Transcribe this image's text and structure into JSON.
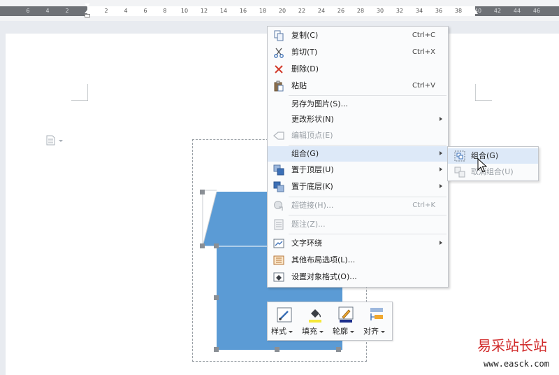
{
  "ruler": {
    "numbers": [
      "6",
      "4",
      "2",
      "2",
      "4",
      "6",
      "8",
      "10",
      "12",
      "14",
      "16",
      "18",
      "20",
      "22",
      "24",
      "26",
      "28",
      "30",
      "32",
      "34",
      "36",
      "38",
      "40",
      "42",
      "44",
      "46"
    ]
  },
  "context_menu": {
    "items": [
      {
        "label": "复制(C)",
        "shortcut": "Ctrl+C",
        "icon": "copy-icon"
      },
      {
        "label": "剪切(T)",
        "shortcut": "Ctrl+X",
        "icon": "scissors-icon"
      },
      {
        "label": "删除(D)",
        "icon": "delete-x-icon"
      },
      {
        "label": "粘贴",
        "shortcut": "Ctrl+V",
        "icon": "paste-icon"
      },
      {
        "label": "另存为图片(S)..."
      },
      {
        "label": "更改形状(N)"
      },
      {
        "label": "编辑顶点(E)",
        "icon": "edit-points-icon"
      },
      {
        "label": "组合(G)"
      },
      {
        "label": "置于顶层(U)",
        "icon": "bring-front-icon"
      },
      {
        "label": "置于底层(K)",
        "icon": "send-back-icon"
      },
      {
        "label": "超链接(H)...",
        "shortcut": "Ctrl+K",
        "icon": "hyperlink-icon"
      },
      {
        "label": "题注(Z)...",
        "icon": "caption-icon"
      },
      {
        "label": "文字环绕",
        "icon": "text-wrap-icon"
      },
      {
        "label": "其他布局选项(L)...",
        "icon": "layout-options-icon"
      },
      {
        "label": "设置对象格式(O)...",
        "icon": "format-object-icon"
      }
    ]
  },
  "submenu": {
    "items": [
      {
        "label": "组合(G)",
        "icon": "group-icon"
      },
      {
        "label": "取消组合(U)",
        "icon": "ungroup-icon"
      }
    ]
  },
  "mini_toolbar": {
    "style_label": "样式",
    "fill_label": "填充",
    "outline_label": "轮廓",
    "align_label": "对齐"
  },
  "watermark": {
    "cn": "易采站长站",
    "url": "www.easck.com"
  },
  "colors": {
    "shape_fill": "#5b9bd5",
    "menu_highlight": "#dde9f8",
    "watermark_red": "#d12a2a"
  }
}
